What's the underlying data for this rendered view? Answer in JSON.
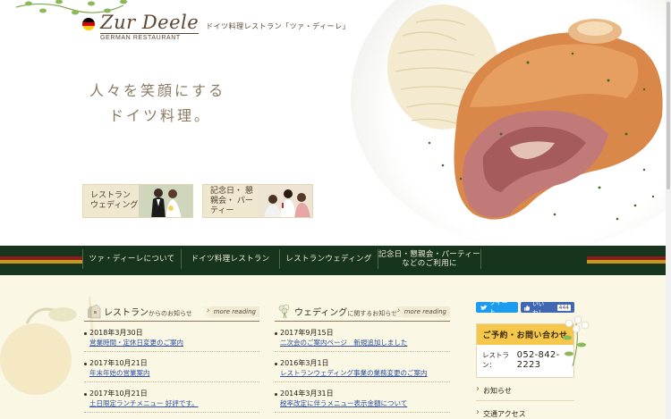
{
  "header": {
    "logo_script": "Zur Deele",
    "logo_sub": "GERMAN RESTAURANT",
    "logo_jp": "ドイツ料理レストラン「ツァ・ディーレ」",
    "flag_colors": [
      "#000000",
      "#dd0000",
      "#ffce00"
    ]
  },
  "hero": {
    "catch_line1": "人々を笑顔にする",
    "catch_line2": "ドイツ料理。",
    "banner1_label": "レストラン ウェディング",
    "banner2_label": "記念日・ 懇親会・ パーティー"
  },
  "nav": {
    "items": [
      {
        "label": "ツァ・ディーレについて"
      },
      {
        "label": "ドイツ料理レストラン"
      },
      {
        "label": "レストランウェディング"
      },
      {
        "label": "記念日・懇親会・パーティー などのご利用に"
      }
    ]
  },
  "news_restaurant": {
    "title_main": "レストラン",
    "title_small": "からのお知らせ",
    "more": "more reading",
    "items": [
      {
        "date": "2018年3月30日",
        "text": "営業時間・定休日変更のご案内"
      },
      {
        "date": "2017年10月21日",
        "text": "年末年始の営業案内"
      },
      {
        "date": "2017年10月21日",
        "text": "土日限定ランチメニュー 好評です。"
      }
    ]
  },
  "news_wedding": {
    "title_main": "ウェディング",
    "title_small": "に関するお知らせ",
    "more": "more reading",
    "items": [
      {
        "date": "2017年9月15日",
        "text": "二次会のご案内ページ　新規追加しました"
      },
      {
        "date": "2016年3月1日",
        "text": "レストランウェディング事業の業務変更のご案内"
      },
      {
        "date": "2014年3月31日",
        "text": "税率改定に伴うメニュー表示金額について"
      }
    ]
  },
  "sidebar": {
    "tweet_label": "ツイート",
    "like_label": "いいね！",
    "like_count": "444",
    "reserve_title": "ご予約・お問い合わせ",
    "reserve_prefix": "レストラン：",
    "reserve_tel": "052-842-2223",
    "links": [
      {
        "label": "お知らせ"
      },
      {
        "label": "交通アクセス"
      }
    ]
  }
}
